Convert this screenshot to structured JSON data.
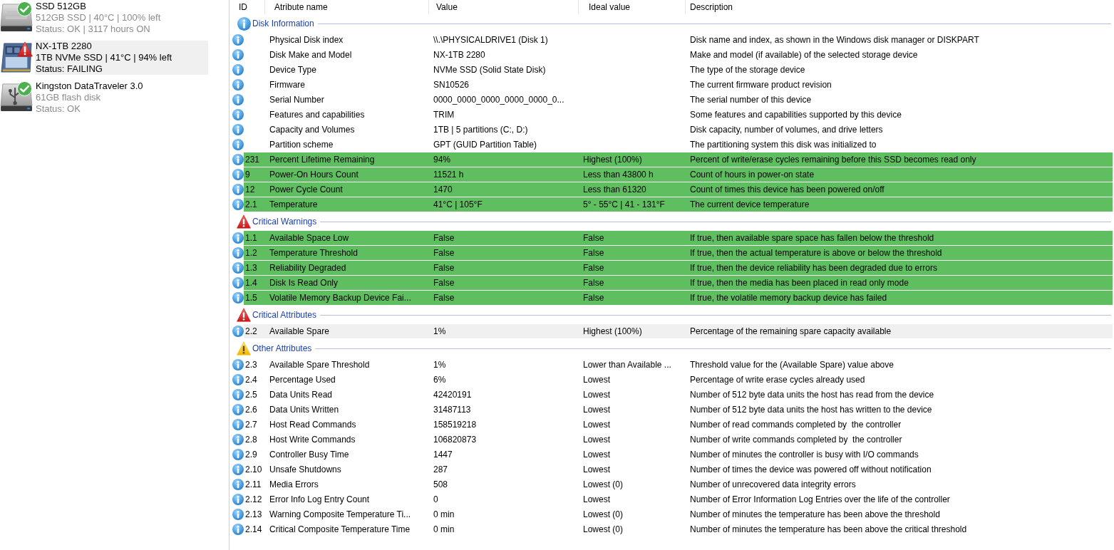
{
  "disks": [
    {
      "kind": "ssd",
      "failing": false,
      "name": "SSD 512GB",
      "details": "512GB SSD | 40°C | 100% left",
      "status": "Status: OK | 3117 hours ON",
      "selected": false
    },
    {
      "kind": "nvme",
      "failing": true,
      "name": "NX-1TB 2280",
      "details": "1TB NVMe SSD | 41°C | 94% left",
      "status": "Status: FAILING",
      "selected": true
    },
    {
      "kind": "usb",
      "failing": false,
      "name": "Kingston DataTraveler 3.0",
      "details": "61GB flash disk",
      "status": "Status: OK",
      "selected": false
    }
  ],
  "columns": [
    "ID",
    "Atribute name",
    "Value",
    "Ideal value",
    "Description"
  ],
  "groups": [
    {
      "kind": "info",
      "title": "Disk Information",
      "rows": [
        {
          "name": "Physical Disk index",
          "value": "\\\\.\\PHYSICALDRIVE1 (Disk 1)",
          "description": "Disk name and index, as shown in the Windows disk manager or DISKPART",
          "highlighted": false,
          "selected": false
        },
        {
          "name": "Disk Make and Model",
          "value": "NX-1TB 2280",
          "description": "Make and model (if available) of the selected storage device",
          "highlighted": false,
          "selected": false
        },
        {
          "name": "Device Type",
          "value": "NVMe SSD (Solid State Disk)",
          "description": "The type of the storage device",
          "highlighted": false,
          "selected": false
        },
        {
          "name": "Firmware",
          "value": "SN10526",
          "description": "The current firmware product revision",
          "highlighted": false,
          "selected": false
        },
        {
          "name": "Serial Number",
          "value": "0000_0000_0000_0000_0000_0...",
          "description": "The serial number of this device",
          "highlighted": false,
          "selected": false
        },
        {
          "name": "Features and capabilities",
          "value": "TRIM",
          "description": "Some features and capabilities supported by this device",
          "highlighted": false,
          "selected": false
        },
        {
          "name": "Capacity and Volumes",
          "value": "1TB | 5 partitions (C:, D:)",
          "description": "Disk capacity, number of volumes, and drive letters",
          "highlighted": false,
          "selected": false
        },
        {
          "name": "Partition scheme",
          "value": "GPT (GUID Partition Table)",
          "description": "The partitioning system this disk was initialized to",
          "highlighted": false,
          "selected": false
        },
        {
          "id": "231",
          "name": "Percent Lifetime Remaining",
          "value": "94%",
          "ideal": "Highest (100%)",
          "description": "Percent of write/erase cycles remaining before this SSD becomes read only",
          "highlighted": true,
          "selected": false
        },
        {
          "id": "9",
          "name": "Power-On Hours Count",
          "value": "11521 h",
          "ideal": "Less than 43800 h",
          "description": "Count of hours in power-on state",
          "highlighted": true,
          "selected": false
        },
        {
          "id": "12",
          "name": "Power Cycle Count",
          "value": "1470",
          "ideal": "Less than 61320",
          "description": "Count of times this device has been powered on/off",
          "highlighted": true,
          "selected": false
        },
        {
          "id": "2.1",
          "name": "Temperature",
          "value": "41°C | 105°F",
          "ideal": "5° - 55°C | 41 - 131°F",
          "description": "The current device temperature",
          "highlighted": true,
          "selected": false
        }
      ]
    },
    {
      "kind": "critical",
      "title": "Critical Warnings",
      "rows": [
        {
          "id": "1.1",
          "name": "Available Space Low",
          "value": "False",
          "ideal": "False",
          "description": "If true, then available spare space has fallen below the threshold",
          "highlighted": true,
          "selected": false
        },
        {
          "id": "1.2",
          "name": "Temperature Threshold",
          "value": "False",
          "ideal": "False",
          "description": "If true, then the actual temperature is above or below the threshold",
          "highlighted": true,
          "selected": false
        },
        {
          "id": "1.3",
          "name": "Reliability Degraded",
          "value": "False",
          "ideal": "False",
          "description": "If true, then the device reliability has been degraded due to errors",
          "highlighted": true,
          "selected": false
        },
        {
          "id": "1.4",
          "name": "Disk Is Read Only",
          "value": "False",
          "ideal": "False",
          "description": "If true, then the media has been placed in read only mode",
          "highlighted": true,
          "selected": false
        },
        {
          "id": "1.5",
          "name": "Volatile Memory Backup Device Fai...",
          "value": "False",
          "ideal": "False",
          "description": "If true, the volatile memory backup device has failed",
          "highlighted": true,
          "selected": false
        }
      ]
    },
    {
      "kind": "critical",
      "title": "Critical Attributes",
      "rows": [
        {
          "id": "2.2",
          "name": "Available Spare",
          "value": "1%",
          "ideal": "Highest (100%)",
          "description": "Percentage of the remaining spare capacity available",
          "highlighted": false,
          "selected": true
        }
      ]
    },
    {
      "kind": "warning",
      "title": "Other Attributes",
      "rows": [
        {
          "id": "2.3",
          "name": "Available Spare Threshold",
          "value": "1%",
          "ideal": "Lower than Available ...",
          "description": "Threshold value for the (Available Spare) value above",
          "highlighted": false,
          "selected": false
        },
        {
          "id": "2.4",
          "name": "Percentage Used",
          "value": "6%",
          "ideal": "Lowest",
          "description": "Percentage of write erase cycles already used",
          "highlighted": false,
          "selected": false
        },
        {
          "id": "2.5",
          "name": "Data Units Read",
          "value": "42420191",
          "ideal": "Lowest",
          "description": "Number of 512 byte data units the host has read from the device",
          "highlighted": false,
          "selected": false
        },
        {
          "id": "2.6",
          "name": "Data Units Written",
          "value": "31487113",
          "ideal": "Lowest",
          "description": "Number of 512 byte data units the host has written to the device",
          "highlighted": false,
          "selected": false
        },
        {
          "id": "2.7",
          "name": "Host Read Commands",
          "value": "158519218",
          "ideal": "Lowest",
          "description": "Number of read commands completed by  the controller",
          "highlighted": false,
          "selected": false
        },
        {
          "id": "2.8",
          "name": "Host Write Commands",
          "value": "106820873",
          "ideal": "Lowest",
          "description": "Number of write commands completed by  the controller",
          "highlighted": false,
          "selected": false
        },
        {
          "id": "2.9",
          "name": "Controller Busy Time",
          "value": "1447",
          "ideal": "Lowest",
          "description": "Number of minutes the controller is busy with I/O commands",
          "highlighted": false,
          "selected": false
        },
        {
          "id": "2.10",
          "name": "Unsafe Shutdowns",
          "value": "287",
          "ideal": "Lowest",
          "description": "Number of times the device was powered off without notification",
          "highlighted": false,
          "selected": false
        },
        {
          "id": "2.11",
          "name": "Media Errors",
          "value": "508",
          "ideal": "Lowest (0)",
          "description": "Number of unrecovered data integrity errors",
          "highlighted": false,
          "selected": false
        },
        {
          "id": "2.12",
          "name": "Error Info Log Entry Count",
          "value": "0",
          "ideal": "Lowest",
          "description": "Number of Error Information Log Entries over the life of the controller",
          "highlighted": false,
          "selected": false
        },
        {
          "id": "2.13",
          "name": "Warning Composite Temperature Ti...",
          "value": "0 min",
          "ideal": "Lowest (0)",
          "description": "Number of minutes the temperature has been above the threshold",
          "highlighted": false,
          "selected": false
        },
        {
          "id": "2.14",
          "name": "Critical Composite Temperature Time",
          "value": "0 min",
          "ideal": "Lowest (0)",
          "description": "Number of minutes the temperature has been above the critical threshold",
          "highlighted": false,
          "selected": false
        }
      ]
    }
  ]
}
